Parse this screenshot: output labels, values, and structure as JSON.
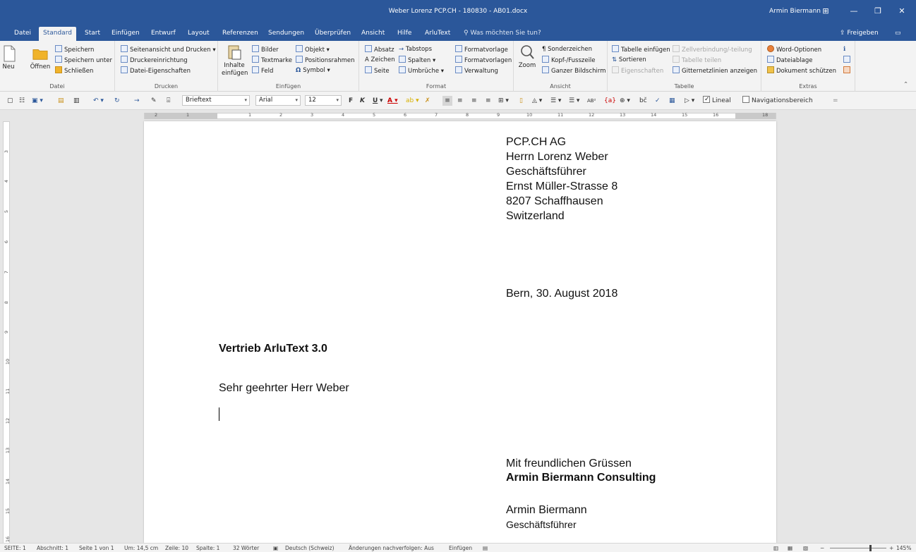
{
  "window": {
    "title": "Weber Lorenz PCP.CH - 180830 - AB01.docx",
    "user": "Armin Biermann"
  },
  "tabs": [
    "Datei",
    "Standard",
    "Start",
    "Einfügen",
    "Entwurf",
    "Layout",
    "Referenzen",
    "Sendungen",
    "Überprüfen",
    "Ansicht",
    "Hilfe",
    "ArluText"
  ],
  "active_tab": "Standard",
  "search_placeholder": "Was möchten Sie tun?",
  "share_label": "Freigeben",
  "ribbon": {
    "datei": {
      "label": "Datei",
      "neu": "Neu",
      "oeffnen": "Öffnen",
      "speichern": "Speichern",
      "speichern_unter": "Speichern unter",
      "schliessen": "Schließen"
    },
    "drucken": {
      "label": "Drucken",
      "seitenansicht": "Seitenansicht und Drucken",
      "druckereinrichtung": "Druckereinrichtung",
      "datei_eigenschaften": "Datei-Eigenschaften"
    },
    "einfuegen": {
      "label": "Einfügen",
      "inhalte_1": "Inhalte",
      "inhalte_2": "einfügen",
      "bilder": "Bilder",
      "textmarke": "Textmarke",
      "feld": "Feld",
      "objekt": "Objekt",
      "positionsrahmen": "Positionsrahmen",
      "symbol": "Symbol"
    },
    "format": {
      "label": "Format",
      "absatz": "Absatz",
      "zeichen": "Zeichen",
      "seite": "Seite",
      "tabstops": "Tabstops",
      "spalten": "Spalten",
      "umbrueche": "Umbrüche",
      "formatvorlage": "Formatvorlage",
      "formatvorlagen": "Formatvorlagen",
      "verwaltung": "Verwaltung"
    },
    "ansicht": {
      "label": "Ansicht",
      "zoom": "Zoom",
      "sonderzeichen": "Sonderzeichen",
      "kopf_fusszeile": "Kopf-/Fusszeile",
      "ganzer_bildschirm": "Ganzer Bildschirm"
    },
    "tabelle": {
      "label": "Tabelle",
      "tabelle_einfuegen": "Tabelle einfügen",
      "sortieren": "Sortieren",
      "eigenschaften": "Eigenschaften",
      "zellverbindung": "Zellverbindung/-teilung",
      "tabelle_teilen": "Tabelle teilen",
      "gitternetzlinien": "Gitternetzlinien anzeigen"
    },
    "extras": {
      "label": "Extras",
      "word_optionen": "Word-Optionen",
      "dateiablage": "Dateiablage",
      "dokument_schuetzen": "Dokument schützen"
    }
  },
  "format_toolbar": {
    "style": "Brieftext",
    "font": "Arial",
    "size": "12",
    "bold": "F",
    "italic": "K",
    "underline": "U",
    "lineal": "Lineal",
    "navigationsbereich": "Navigationsbereich"
  },
  "ruler_h": [
    "2",
    "1",
    "1",
    "2",
    "3",
    "4",
    "5",
    "6",
    "7",
    "8",
    "9",
    "10",
    "11",
    "12",
    "13",
    "14",
    "15",
    "16",
    "18"
  ],
  "ruler_v": [
    "3",
    "4",
    "5",
    "6",
    "7",
    "8",
    "9",
    "10",
    "11",
    "12",
    "13",
    "14",
    "15",
    "16"
  ],
  "document": {
    "recipient": [
      "PCP.CH AG",
      "Herrn Lorenz Weber",
      "Geschäftsführer",
      "Ernst Müller-Strasse 8",
      "8207 Schaffhausen",
      "Switzerland"
    ],
    "date": "Bern, 30. August 2018",
    "subject": "Vertrieb ArluText 3.0",
    "salutation": "Sehr geehrter Herr Weber",
    "closing": "Mit freundlichen Grüssen",
    "company": "Armin Biermann Consulting",
    "signer_name": "Armin Biermann",
    "signer_title": "Geschäftsführer"
  },
  "status": {
    "seite": "SEITE: 1",
    "abschnitt": "Abschnitt: 1",
    "seite_von": "Seite 1 von 1",
    "um": "Um: 14,5 cm",
    "zeile": "Zeile: 10",
    "spalte": "Spalte: 1",
    "woerter": "32 Wörter",
    "sprache": "Deutsch (Schweiz)",
    "aenderungen": "Änderungen nachverfolgen: Aus",
    "einfuegen": "Einfügen",
    "zoom": "145%"
  }
}
